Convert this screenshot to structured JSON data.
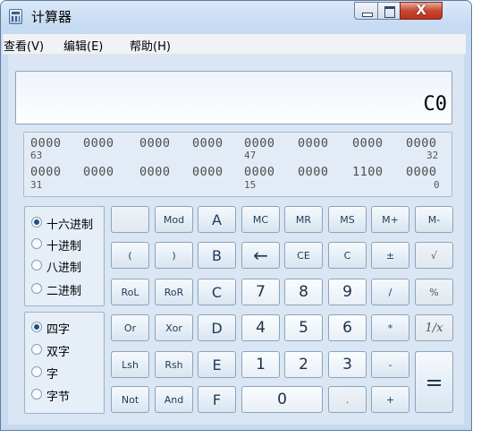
{
  "window": {
    "title": "计算器"
  },
  "menu": [
    "查看(V)",
    "编辑(E)",
    "帮助(H)"
  ],
  "display": {
    "value": "C0"
  },
  "binary": {
    "row1": [
      "0000",
      "0000",
      "0000",
      "0000",
      "0000",
      "0000",
      "0000",
      "0000"
    ],
    "row1_pos": {
      "a": "63",
      "b": "47",
      "c": "32"
    },
    "row2": [
      "0000",
      "0000",
      "0000",
      "0000",
      "0000",
      "0000",
      "1100",
      "0000"
    ],
    "row2_pos": {
      "a": "31",
      "b": "15",
      "c": "0"
    }
  },
  "base_options": [
    {
      "label": "十六进制",
      "selected": true
    },
    {
      "label": "十进制",
      "selected": false
    },
    {
      "label": "八进制",
      "selected": false
    },
    {
      "label": "二进制",
      "selected": false
    }
  ],
  "word_options": [
    {
      "label": "四字",
      "selected": true
    },
    {
      "label": "双字",
      "selected": false
    },
    {
      "label": "字",
      "selected": false
    },
    {
      "label": "字节",
      "selected": false
    }
  ],
  "keys": {
    "blank": "",
    "mod": "Mod",
    "a": "A",
    "mc": "MC",
    "mr": "MR",
    "ms": "MS",
    "mplus": "M+",
    "mminus": "M-",
    "lparen": "(",
    "rparen": ")",
    "b": "B",
    "back": "←",
    "ce": "CE",
    "c": "C",
    "plusminus": "±",
    "sqrt": "√",
    "rol": "RoL",
    "ror": "RoR",
    "hc": "C",
    "k7": "7",
    "k8": "8",
    "k9": "9",
    "div": "/",
    "pct": "%",
    "or": "Or",
    "xor": "Xor",
    "d": "D",
    "k4": "4",
    "k5": "5",
    "k6": "6",
    "mul": "*",
    "recip": "1/x",
    "lsh": "Lsh",
    "rsh": "Rsh",
    "e": "E",
    "k1": "1",
    "k2": "2",
    "k3": "3",
    "sub": "-",
    "eq": "=",
    "not": "Not",
    "and": "And",
    "f": "F",
    "k0": "0",
    "dot": ".",
    "add": "+"
  }
}
